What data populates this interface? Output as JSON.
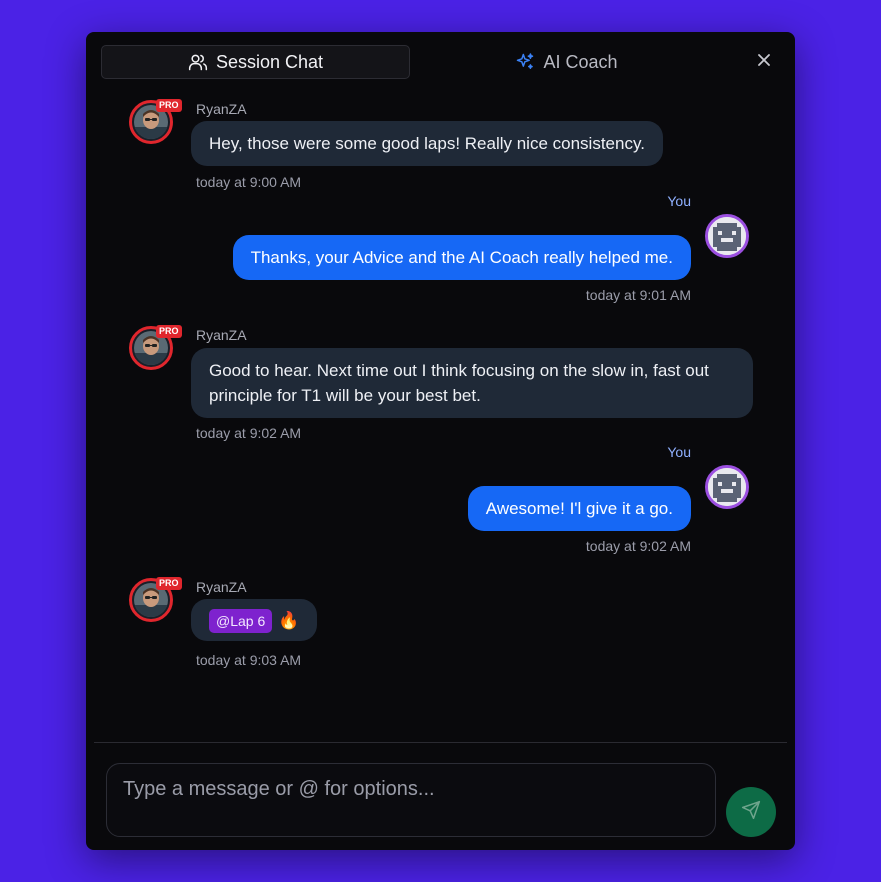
{
  "tabs": {
    "session_chat": "Session Chat",
    "ai_coach": "AI Coach"
  },
  "messages": [
    {
      "sender": "RyanZA",
      "badge": "PRO",
      "text": "Hey, those were some good laps! Really nice consistency.",
      "time": "today at 9:00 AM"
    },
    {
      "sender": "You",
      "text": "Thanks, your Advice and the AI Coach really helped me.",
      "time": "today at 9:01 AM"
    },
    {
      "sender": "RyanZA",
      "badge": "PRO",
      "text": "Good to hear. Next time out I think focusing on the slow in, fast out principle for T1 will be your best bet.",
      "time": "today at 9:02 AM"
    },
    {
      "sender": "You",
      "text": "Awesome! I'l give it a go.",
      "time": "today at 9:02 AM"
    },
    {
      "sender": "RyanZA",
      "badge": "PRO",
      "mention": "@Lap 6",
      "emoji": "🔥",
      "time": "today at 9:03 AM"
    }
  ],
  "composer": {
    "placeholder": "Type a message or @ for options..."
  },
  "colors": {
    "background": "#4b22e6",
    "window": "#09090c",
    "my_bubble": "#1668f5",
    "their_bubble": "#1f2937",
    "pro_badge": "#e0262d",
    "mention": "#7e22ce",
    "send_button": "#0d6b46"
  },
  "icons": {
    "session_tab": "users-icon",
    "coach_tab": "sparkles-icon",
    "close": "close-icon",
    "send": "send-icon"
  }
}
